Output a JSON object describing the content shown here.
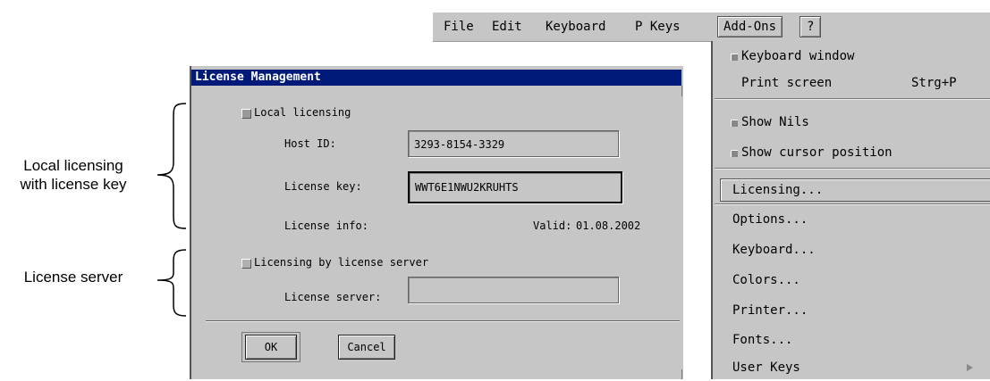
{
  "menubar": {
    "items": [
      {
        "label": "File",
        "name": "menu-file"
      },
      {
        "label": "Edit",
        "name": "menu-edit"
      },
      {
        "label": "Keyboard",
        "name": "menu-keyboard"
      },
      {
        "label": "P Keys",
        "name": "menu-p-keys"
      },
      {
        "label": "Add-Ons",
        "name": "menu-add-ons",
        "active": true
      },
      {
        "label": "?",
        "name": "menu-help"
      }
    ]
  },
  "dropdown": {
    "items": [
      {
        "label": "Keyboard window",
        "checked": true
      },
      {
        "label": "Print screen",
        "shortcut": "Strg+P"
      },
      {
        "label": "Show Nils",
        "checked": true
      },
      {
        "label": "Show cursor position",
        "checked": true
      },
      {
        "label": "Licensing...",
        "highlighted": true
      },
      {
        "label": "Options..."
      },
      {
        "label": "Keyboard..."
      },
      {
        "label": "Colors..."
      },
      {
        "label": "Printer..."
      },
      {
        "label": "Fonts..."
      },
      {
        "label": "User Keys",
        "submenu": true
      }
    ]
  },
  "dialog": {
    "title": "License Management",
    "local_licensing": {
      "label": "Local licensing",
      "checked": true
    },
    "host_id": {
      "label": "Host ID:",
      "value": "3293-8154-3329"
    },
    "license_key": {
      "label": "License key:",
      "value": "WWT6E1NWU2KRUHTS"
    },
    "license_info": {
      "label": "License info:",
      "valid_label": "Valid:",
      "valid_date": "01.08.2002"
    },
    "server_licensing": {
      "label": "Licensing by license server",
      "checked": false
    },
    "license_server": {
      "label": "License server:",
      "value": ""
    },
    "buttons": {
      "ok": "OK",
      "cancel": "Cancel"
    }
  },
  "annotations": {
    "local_line1": "Local licensing",
    "local_line2": "with license key",
    "server": "License server"
  },
  "colors": {
    "title_bar": "#001a7a",
    "panel": "#c6c6c6"
  }
}
